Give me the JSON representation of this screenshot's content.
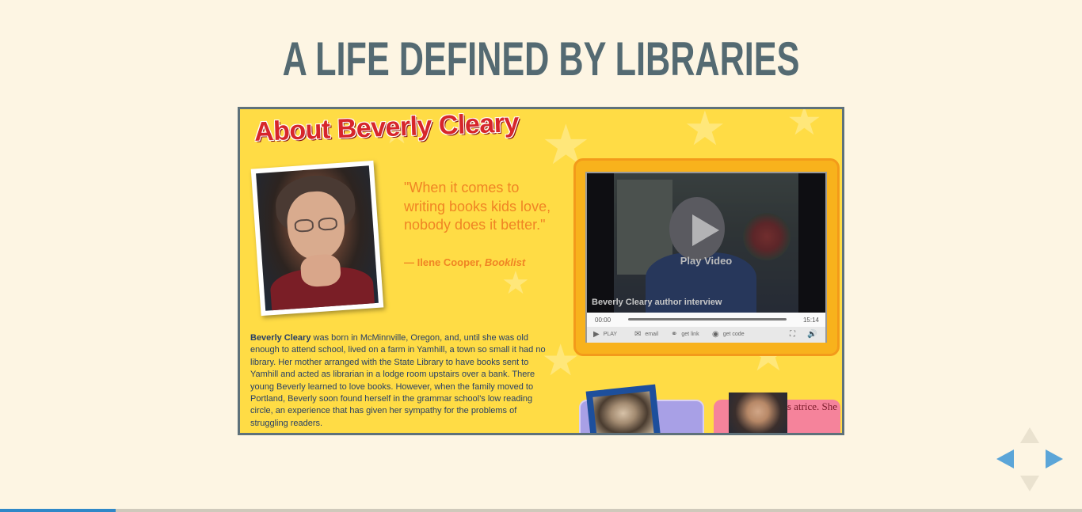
{
  "slide": {
    "title": "A LIFE DEFINED BY LIBRARIES"
  },
  "embed": {
    "heading": "About Beverly Cleary",
    "quote": "\"When it comes to writing books kids love, nobody does it better.\"",
    "quote_attrib_prefix": "— Ilene Cooper, ",
    "quote_attrib_source": "Booklist",
    "bio_name": "Beverly Cleary",
    "bio_text": " was born in McMinnville, Oregon, and, until she was old enough to attend school, lived on a farm in Yamhill, a town so small it had no library. Her mother arranged with the State Library to have books sent to Yamhill and acted as librarian in a lodge room upstairs over a bank. There young Beverly learned to love books. However, when the family moved to Portland, Beverly soon found herself in the grammar school's low reading circle, an experience that has given her sympathy for the problems of struggling readers.",
    "pink_card_text": "e a pest,\" s atrice. She"
  },
  "video": {
    "play_label": "Play Video",
    "caption": "Beverly Cleary author interview",
    "time_current": "00:00",
    "time_total": "15:14",
    "controls": {
      "play": "PLAY",
      "email": "email",
      "get_link": "get link",
      "get_code": "get code"
    }
  },
  "navigation": {
    "progress_fraction": 0.107,
    "left_enabled": true,
    "right_enabled": true,
    "up_enabled": false,
    "down_enabled": false
  },
  "colors": {
    "title": "#546a72",
    "background": "#fdf5e3",
    "nav_active": "#5ba5d8",
    "progress": "#2f88c8"
  }
}
